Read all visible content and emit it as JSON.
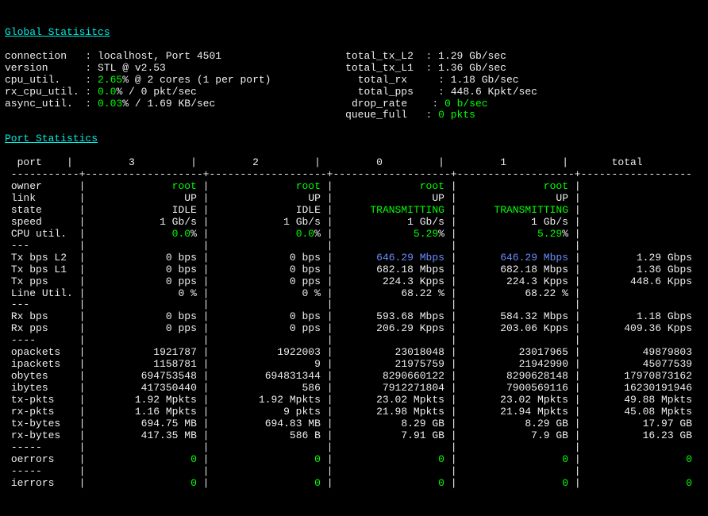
{
  "headings": {
    "global": "Global Statisitcs",
    "port": "Port Statistics"
  },
  "global_left": {
    "connection_label": "connection",
    "connection_value": "localhost, Port 4501",
    "version_label": "version",
    "version_value": "STL @ v2.53",
    "cpu_util_label": "cpu_util.",
    "cpu_util_value": "2.65",
    "cpu_util_suffix": "% @ 2 cores (1 per port)",
    "rx_cpu_util_label": "rx_cpu_util.",
    "rx_cpu_util_value": "0.0",
    "rx_cpu_util_suffix": "% / 0 pkt/sec",
    "async_util_label": "async_util.",
    "async_util_value": "0.03",
    "async_util_suffix": "% / 1.69 KB/sec"
  },
  "global_right": {
    "total_tx_l2_label": "total_tx_L2",
    "total_tx_l2_value": "1.29 Gb/sec",
    "total_tx_l1_label": "total_tx_L1",
    "total_tx_l1_value": "1.36 Gb/sec",
    "total_rx_label": "total_rx",
    "total_rx_value": "1.18 Gb/sec",
    "total_pps_label": "total_pps",
    "total_pps_value": "448.6 Kpkt/sec",
    "drop_rate_label": "drop_rate",
    "drop_rate_value": "0 b/sec",
    "queue_full_label": "queue_full",
    "queue_full_value": "0 pkts"
  },
  "port_header": {
    "port": "port",
    "c0": "3",
    "c1": "2",
    "c2": "0",
    "c3": "1",
    "total": "total"
  },
  "rows": {
    "owner": {
      "label": "owner",
      "v": [
        "root",
        "root",
        "root",
        "root",
        ""
      ]
    },
    "link": {
      "label": "link",
      "v": [
        "UP",
        "UP",
        "UP",
        "UP",
        ""
      ]
    },
    "state": {
      "label": "state",
      "v": [
        "IDLE",
        "IDLE",
        "TRANSMITTING",
        "TRANSMITTING",
        ""
      ]
    },
    "speed": {
      "label": "speed",
      "v": [
        "1 Gb/s",
        "1 Gb/s",
        "1 Gb/s",
        "1 Gb/s",
        ""
      ]
    },
    "cpu": {
      "label": "CPU util.",
      "v": [
        "0.0",
        "0.0",
        "5.29",
        "5.29",
        ""
      ],
      "suffix": "%"
    },
    "dash1": {
      "label": "---"
    },
    "txl2": {
      "label": "Tx bps L2",
      "v": [
        "0 bps",
        "0 bps",
        "646.29 Mbps",
        "646.29 Mbps",
        "1.29 Gbps"
      ]
    },
    "txl1": {
      "label": "Tx bps L1",
      "v": [
        "0 bps",
        "0 bps",
        "682.18 Mbps",
        "682.18 Mbps",
        "1.36 Gbps"
      ]
    },
    "txpps": {
      "label": "Tx pps",
      "v": [
        "0 pps",
        "0 pps",
        "224.3 Kpps",
        "224.3 Kpps",
        "448.6 Kpps"
      ]
    },
    "lineutil": {
      "label": "Line Util.",
      "v": [
        "0 %",
        "0 %",
        "68.22 %",
        "68.22 %",
        ""
      ]
    },
    "dash2": {
      "label": "---"
    },
    "rxbps": {
      "label": "Rx bps",
      "v": [
        "0 bps",
        "0 bps",
        "593.68 Mbps",
        "584.32 Mbps",
        "1.18 Gbps"
      ]
    },
    "rxpps": {
      "label": "Rx pps",
      "v": [
        "0 pps",
        "0 pps",
        "206.29 Kpps",
        "203.06 Kpps",
        "409.36 Kpps"
      ]
    },
    "dash3": {
      "label": "----"
    },
    "opackets": {
      "label": "opackets",
      "v": [
        "1921787",
        "1922003",
        "23018048",
        "23017965",
        "49879803"
      ]
    },
    "ipackets": {
      "label": "ipackets",
      "v": [
        "1158781",
        "9",
        "21975759",
        "21942990",
        "45077539"
      ]
    },
    "obytes": {
      "label": "obytes",
      "v": [
        "694753548",
        "694831344",
        "8290660122",
        "8290628148",
        "17970873162"
      ]
    },
    "ibytes": {
      "label": "ibytes",
      "v": [
        "417350440",
        "586",
        "7912271804",
        "7900569116",
        "16230191946"
      ]
    },
    "txpkts": {
      "label": "tx-pkts",
      "v": [
        "1.92 Mpkts",
        "1.92 Mpkts",
        "23.02 Mpkts",
        "23.02 Mpkts",
        "49.88 Mpkts"
      ]
    },
    "rxpkts": {
      "label": "rx-pkts",
      "v": [
        "1.16 Mpkts",
        "9 pkts",
        "21.98 Mpkts",
        "21.94 Mpkts",
        "45.08 Mpkts"
      ]
    },
    "txbytes": {
      "label": "tx-bytes",
      "v": [
        "694.75 MB",
        "694.83 MB",
        "8.29 GB",
        "8.29 GB",
        "17.97 GB"
      ]
    },
    "rxbytes": {
      "label": "rx-bytes",
      "v": [
        "417.35 MB",
        "586 B",
        "7.91 GB",
        "7.9 GB",
        "16.23 GB"
      ]
    },
    "dash4": {
      "label": "-----"
    },
    "oerrors": {
      "label": "oerrors",
      "v": [
        "0",
        "0",
        "0",
        "0",
        "0"
      ]
    },
    "dash5": {
      "label": "-----"
    },
    "ierrors": {
      "label": "ierrors",
      "v": [
        "0",
        "0",
        "0",
        "0",
        "0"
      ]
    }
  }
}
